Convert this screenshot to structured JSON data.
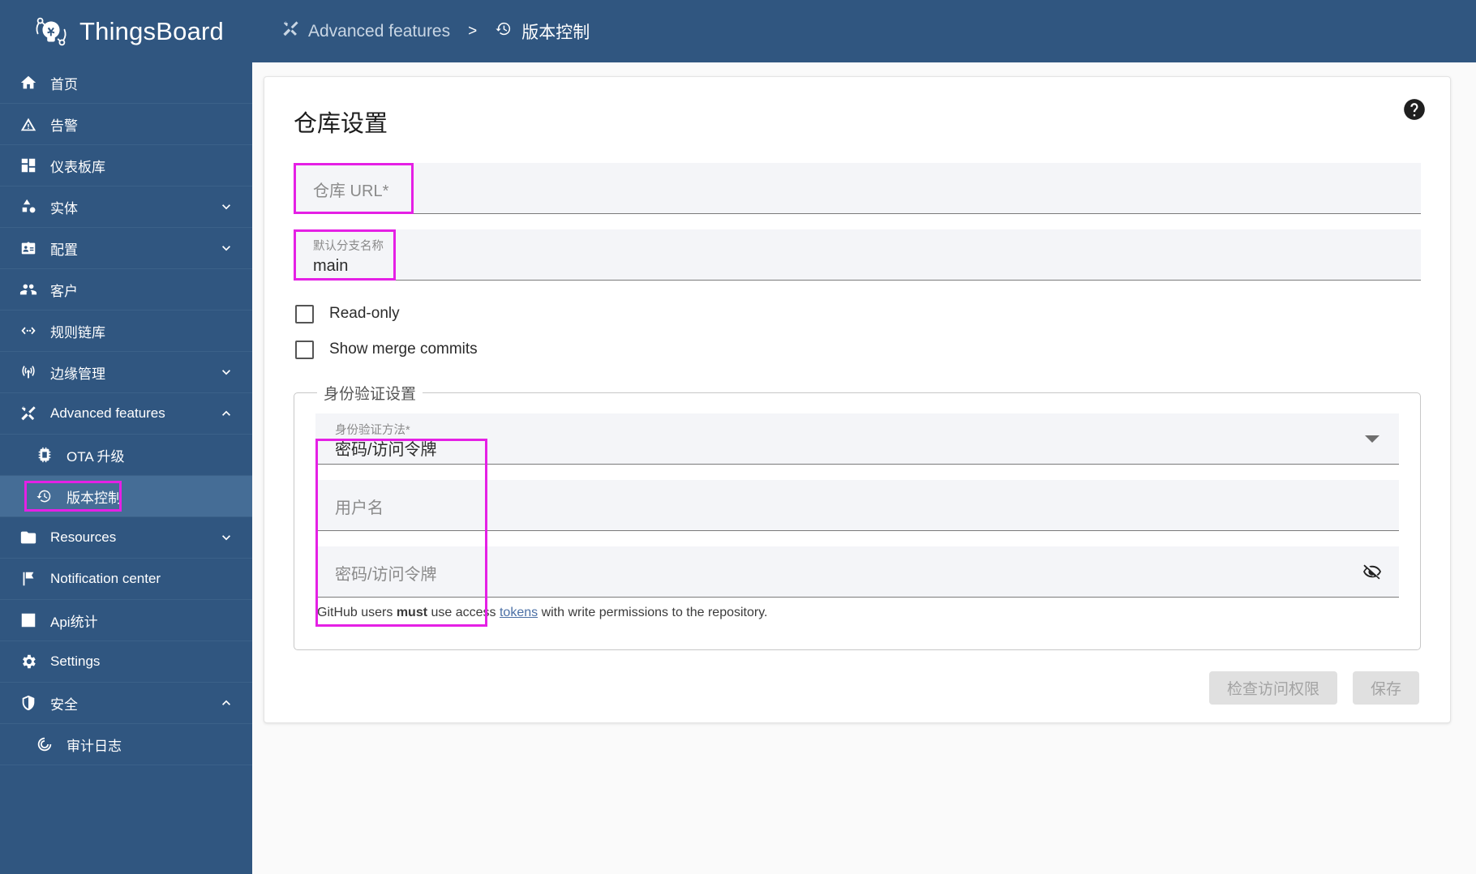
{
  "brand": {
    "name": "ThingsBoard",
    "logo_icon": "thingsboard-logo-icon"
  },
  "sidebar": {
    "items": [
      {
        "label": "首页",
        "icon": "home-icon",
        "name": "home",
        "expandable": false,
        "level": 0
      },
      {
        "label": "告警",
        "icon": "alarm-warning-icon",
        "name": "alarms",
        "expandable": false,
        "level": 0
      },
      {
        "label": "仪表板库",
        "icon": "dashboards-icon",
        "name": "dashboards",
        "expandable": false,
        "level": 0
      },
      {
        "label": "实体",
        "icon": "entities-icon",
        "name": "entities",
        "expandable": true,
        "expanded": false,
        "level": 0
      },
      {
        "label": "配置",
        "icon": "profiles-icon",
        "name": "profiles",
        "expandable": true,
        "expanded": false,
        "level": 0
      },
      {
        "label": "客户",
        "icon": "customers-icon",
        "name": "customers",
        "expandable": false,
        "level": 0
      },
      {
        "label": "规则链库",
        "icon": "rule-chains-icon",
        "name": "rule-chains",
        "expandable": false,
        "level": 0
      },
      {
        "label": "边缘管理",
        "icon": "edge-management-icon",
        "name": "edge-management",
        "expandable": true,
        "expanded": false,
        "level": 0
      },
      {
        "label": "Advanced features",
        "icon": "tools-icon",
        "name": "advanced-features",
        "expandable": true,
        "expanded": true,
        "level": 0
      },
      {
        "label": "OTA 升级",
        "icon": "chip-icon",
        "name": "ota-updates",
        "expandable": false,
        "level": 1
      },
      {
        "label": "版本控制",
        "icon": "history-clock-icon",
        "name": "version-control",
        "expandable": false,
        "level": 1,
        "active": true,
        "highlighted": true
      },
      {
        "label": "Resources",
        "icon": "folder-icon",
        "name": "resources",
        "expandable": true,
        "expanded": false,
        "level": 0
      },
      {
        "label": "Notification center",
        "icon": "flag-icon",
        "name": "notification-center",
        "expandable": false,
        "level": 0
      },
      {
        "label": "Api统计",
        "icon": "bar-chart-icon",
        "name": "api-usage",
        "expandable": false,
        "level": 0
      },
      {
        "label": "Settings",
        "icon": "gear-icon",
        "name": "settings",
        "expandable": false,
        "level": 0
      },
      {
        "label": "安全",
        "icon": "shield-icon",
        "name": "security",
        "expandable": true,
        "expanded": true,
        "level": 0
      },
      {
        "label": "审计日志",
        "icon": "audit-icon",
        "name": "audit-logs",
        "expandable": false,
        "level": 1
      }
    ]
  },
  "breadcrumb": {
    "parent": {
      "label": "Advanced features",
      "icon": "tools-icon"
    },
    "separator": ">",
    "current": {
      "label": "版本控制",
      "icon": "history-clock-icon"
    }
  },
  "page": {
    "title": "仓库设置",
    "help_icon": "help-circle-icon"
  },
  "form": {
    "repository_url": {
      "label": "仓库 URL*",
      "value": "",
      "placeholder": ""
    },
    "default_branch": {
      "label": "默认分支名称",
      "value": "main"
    },
    "read_only": {
      "label": "Read-only",
      "checked": false
    },
    "show_merge_commits": {
      "label": "Show merge commits",
      "checked": false
    },
    "auth_section": {
      "legend": "身份验证设置",
      "auth_method": {
        "label": "身份验证方法*",
        "value": "密码/访问令牌",
        "dropdown_icon": "caret-down-icon"
      },
      "username": {
        "label": "用户名",
        "value": ""
      },
      "password": {
        "label": "密码/访问令牌",
        "value": "",
        "visibility_icon": "eye-off-icon"
      },
      "hint": {
        "prefix": "GitHub users ",
        "bold": "must",
        "middle": " use access ",
        "link": "tokens",
        "suffix": " with write permissions to the repository."
      }
    }
  },
  "actions": {
    "check_access": "检查访问权限",
    "save": "保存"
  },
  "colors": {
    "sidebar_bg": "#305680",
    "sidebar_active": "#456d96",
    "highlight": "#e520e5",
    "field_bg": "#f4f5f8",
    "page_bg": "#fafafa"
  }
}
